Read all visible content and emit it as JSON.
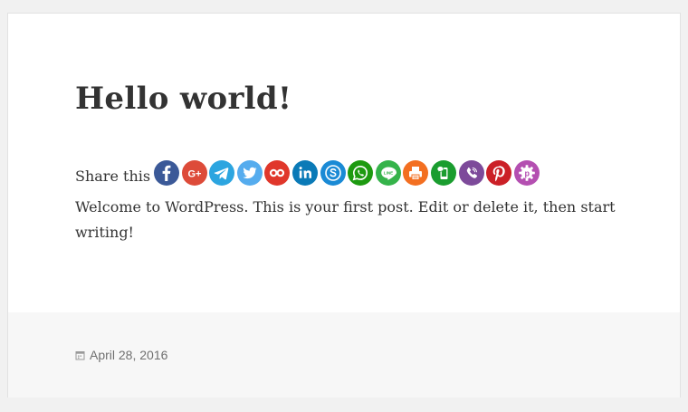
{
  "post": {
    "title": "Hello world!",
    "content": "Welcome to WordPress. This is your first post. Edit or delete it, then start writing!"
  },
  "share": {
    "label": "Share this",
    "buttons": [
      {
        "name": "facebook",
        "color": "#3b5998",
        "icon": "facebook-icon"
      },
      {
        "name": "google-plus",
        "color": "#dd4b39",
        "icon": "google-plus-icon"
      },
      {
        "name": "telegram",
        "color": "#2ca5e0",
        "icon": "telegram-icon"
      },
      {
        "name": "twitter",
        "color": "#55acee",
        "icon": "twitter-icon"
      },
      {
        "name": "flickr",
        "color": "#e0372b",
        "icon": "flickr-icon"
      },
      {
        "name": "linkedin",
        "color": "#0a7ab7",
        "icon": "linkedin-icon"
      },
      {
        "name": "skype",
        "color": "#1a8ad5",
        "icon": "skype-icon"
      },
      {
        "name": "whatsapp",
        "color": "#1d9a10",
        "icon": "whatsapp-icon"
      },
      {
        "name": "line",
        "color": "#35b34a",
        "icon": "line-icon"
      },
      {
        "name": "print",
        "color": "#f36f21",
        "icon": "print-icon"
      },
      {
        "name": "line-it",
        "color": "#1a9d2f",
        "icon": "line-it-icon"
      },
      {
        "name": "viber",
        "color": "#7d4a9a",
        "icon": "viber-icon"
      },
      {
        "name": "pinterest",
        "color": "#cb2027",
        "icon": "pinterest-icon"
      },
      {
        "name": "more",
        "color": "#b44fb1",
        "icon": "more-icon"
      }
    ]
  },
  "footer": {
    "date": "April 28, 2016",
    "date_icon": "calendar-icon"
  }
}
